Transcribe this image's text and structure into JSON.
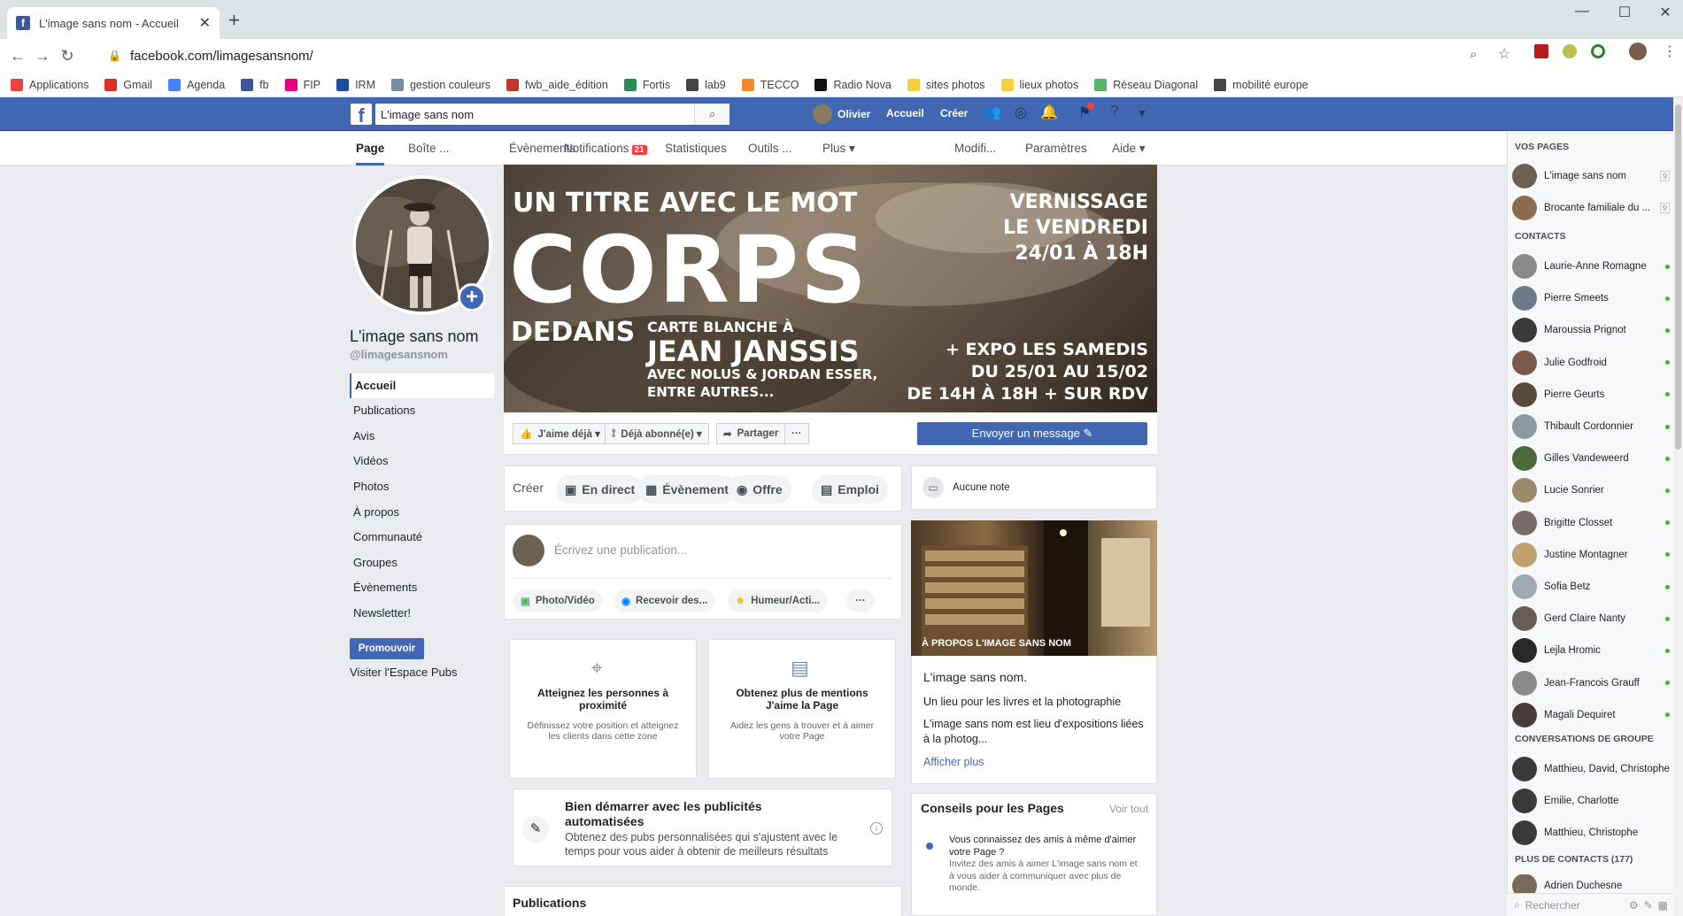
{
  "browser": {
    "tab_title": "L'image sans nom - Accueil",
    "url": "facebook.com/limagesansnom/",
    "bookmarks": [
      {
        "label": "Applications",
        "color": "#e8453c"
      },
      {
        "label": "Gmail",
        "color": "#d93025"
      },
      {
        "label": "Agenda",
        "color": "#4285f4"
      },
      {
        "label": "fb",
        "color": "#3b5998"
      },
      {
        "label": "FIP",
        "color": "#e6007e"
      },
      {
        "label": "IRM",
        "color": "#1a4fa0"
      },
      {
        "label": "gestion couleurs",
        "color": "#7a8aa0"
      },
      {
        "label": "fwb_aide_édition",
        "color": "#c0392b"
      },
      {
        "label": "Fortis",
        "color": "#2e8b57"
      },
      {
        "label": "lab9",
        "color": "#444444"
      },
      {
        "label": "TECCO",
        "color": "#f28c28"
      },
      {
        "label": "Radio Nova",
        "color": "#111111"
      },
      {
        "label": "sites photos",
        "color": "#f4d03f"
      },
      {
        "label": "lieux photos",
        "color": "#f4d03f"
      },
      {
        "label": "Réseau Diagonal",
        "color": "#58b368"
      },
      {
        "label": "mobilité europe",
        "color": "#444444"
      }
    ]
  },
  "fb": {
    "search_value": "L'image sans nom",
    "user": "Olivier",
    "home": "Accueil",
    "create": "Créer"
  },
  "page_tabs": [
    {
      "label": "Page",
      "badge": ""
    },
    {
      "label": "Boîte ...",
      "badge": ""
    },
    {
      "label": "Évènements",
      "badge": ""
    },
    {
      "label": "Notifications",
      "badge": "21"
    },
    {
      "label": "Statistiques",
      "badge": ""
    },
    {
      "label": "Outils ...",
      "badge": ""
    },
    {
      "label": "Plus ▾",
      "badge": ""
    },
    {
      "label": "Modifi...",
      "badge": ""
    },
    {
      "label": "Paramètres",
      "badge": ""
    },
    {
      "label": "Aide ▾",
      "badge": ""
    }
  ],
  "profile": {
    "name": "L'image sans nom",
    "handle": "@limagesansnom"
  },
  "left_nav": [
    "Accueil",
    "Publications",
    "Avis",
    "Vidéos",
    "Photos",
    "À propos",
    "Communauté",
    "Groupes",
    "Évènements",
    "Newsletter!"
  ],
  "promote": "Promouvoir",
  "visit_ads": "Visiter l'Espace Pubs",
  "cover": {
    "l1": "UN TITRE AVEC LE MOT",
    "l2": "CORPS",
    "l3": "DEDANS",
    "l4": "CARTE BLANCHE À",
    "l5": "JEAN JANSSIS",
    "l6": "AVEC NOLUS & JORDAN ESSER,",
    "l7": "ENTRE AUTRES...",
    "r1": "VERNISSAGE",
    "r2": "LE VENDREDI",
    "r3": "24/01 À 18H",
    "r4": "+ EXPO LES SAMEDIS",
    "r5": "DU 25/01 AU 15/02",
    "r6": "DE 14H À 18H + SUR RDV"
  },
  "actions": {
    "like": "J'aime déjà ▾",
    "subscribe": "Déjà abonné(e) ▾",
    "share": "Partager",
    "more": "···",
    "message": "Envoyer un message ✎"
  },
  "create_bar": {
    "label": "Créer",
    "items": [
      "En direct",
      "Évènement",
      "Offre",
      "Emploi"
    ]
  },
  "composer": {
    "placeholder": "Écrivez une publication...",
    "buttons": [
      "Photo/Vidéo",
      "Recevoir des...",
      "Humeur/Acti..."
    ],
    "more": "···"
  },
  "promos": [
    {
      "title": "Atteignez les personnes à proximité",
      "desc": "Définissez votre position et atteignez les clients dans cette zone"
    },
    {
      "title": "Obtenez plus de mentions J'aime la Page",
      "desc": "Aidez les gens à trouver et à aimer votre Page"
    }
  ],
  "auto_ads": {
    "title": "Bien démarrer avec les publicités automatisées",
    "desc": "Obtenez des pubs personnalisées qui s'ajustent avec le temps pour vous aider à obtenir de meilleurs résultats"
  },
  "publications_header": "Publications",
  "note": "Aucune note",
  "about": {
    "overlay": "À PROPOS L'IMAGE SANS NOM",
    "name": "L'image sans nom.",
    "line1": "Un lieu pour les livres et la photographie",
    "line2": "L'image sans nom est lieu d'expositions liées à la photog...",
    "more": "Afficher plus"
  },
  "tips": {
    "title": "Conseils pour les Pages",
    "see_all": "Voir tout",
    "t1": "Vous connaissez des amis à même d'aimer votre Page ?",
    "t2": "Invitez des amis à aimer L'image sans nom et à vous aider à communiquer avec plus de monde."
  },
  "sidebar": {
    "your_pages": "VOS PAGES",
    "pages": [
      {
        "name": "L'image sans nom",
        "count": "9"
      },
      {
        "name": "Brocante familiale du ...",
        "count": "9"
      }
    ],
    "contacts_head": "CONTACTS",
    "contacts": [
      "Laurie-Anne Romagne",
      "Pierre Smeets",
      "Maroussia Prignot",
      "Julie Godfroid",
      "Pierre Geurts",
      "Thibault Cordonnier",
      "Gilles Vandeweerd",
      "Lucie Sonrier",
      "Brigitte Closset",
      "Justine Montagner",
      "Sofia Betz",
      "Gerd Claire Nanty",
      "Lejla Hromic",
      "Jean-Francois Grauff",
      "Magali Dequiret"
    ],
    "groups_head": "CONVERSATIONS DE GROUPE",
    "groups": [
      "Matthieu, David, Christophe",
      "Emilie, Charlotte",
      "Matthieu, Christophe"
    ],
    "more_head": "PLUS DE CONTACTS (177)",
    "more_contact": "Adrien Duchesne",
    "search_placeholder": "Rechercher"
  }
}
